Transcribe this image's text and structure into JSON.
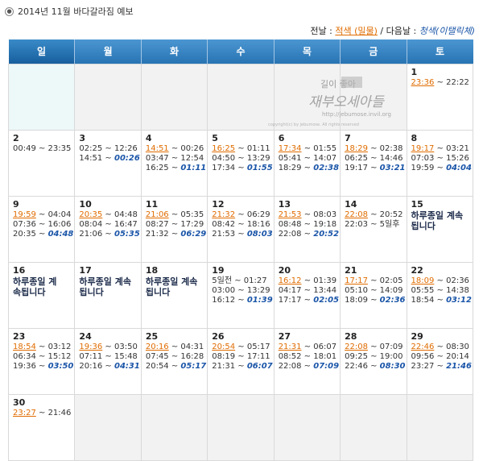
{
  "header": {
    "bullet_icon": "circle-dot-icon",
    "title": "2014년 11월 바다갈라짐 예보"
  },
  "legend": {
    "prefix": "전날 : ",
    "red": "적색 (밀물)",
    "middle": " / 다음날 : ",
    "blue": "청색(이탤릭체)"
  },
  "weekdays": [
    "일",
    "월",
    "화",
    "수",
    "목",
    "금",
    "토"
  ],
  "watermark": {
    "line1": "길이 좋아",
    "line2": "재부오세아들",
    "line3": "http://jebumose.invil.org",
    "line4": "copyright(c) by jebumose. All rights reserved"
  },
  "weeks": [
    [
      {
        "empty": true
      },
      {
        "empty": true
      },
      {
        "empty": true
      },
      {
        "empty": true
      },
      {
        "empty": true
      },
      {
        "empty": true
      },
      {
        "day": "1",
        "lines": [
          [
            {
              "t": "23:36",
              "c": "r"
            },
            {
              "t": " ~ 22:22"
            }
          ]
        ]
      }
    ],
    [
      {
        "day": "2",
        "lines": [
          [
            {
              "t": "00:49 ~ 23:35"
            }
          ]
        ]
      },
      {
        "day": "3",
        "lines": [
          [
            {
              "t": "02:25 ~ 12:26"
            }
          ],
          [
            {
              "t": "14:51 ~ "
            },
            {
              "t": "00:26",
              "c": "b"
            }
          ]
        ]
      },
      {
        "day": "4",
        "lines": [
          [
            {
              "t": "14:51",
              "c": "r"
            },
            {
              "t": " ~ 00:26"
            }
          ],
          [
            {
              "t": "03:47 ~ 12:54"
            }
          ],
          [
            {
              "t": "16:25 ~ "
            },
            {
              "t": "01:11",
              "c": "b"
            }
          ]
        ]
      },
      {
        "day": "5",
        "lines": [
          [
            {
              "t": "16:25",
              "c": "r"
            },
            {
              "t": " ~ 01:11"
            }
          ],
          [
            {
              "t": "04:50 ~ 13:29"
            }
          ],
          [
            {
              "t": "17:34 ~ "
            },
            {
              "t": "01:55",
              "c": "b"
            }
          ]
        ]
      },
      {
        "day": "6",
        "lines": [
          [
            {
              "t": "17:34",
              "c": "r"
            },
            {
              "t": " ~ 01:55"
            }
          ],
          [
            {
              "t": "05:41 ~ 14:07"
            }
          ],
          [
            {
              "t": "18:29 ~ "
            },
            {
              "t": "02:38",
              "c": "b"
            }
          ]
        ]
      },
      {
        "day": "7",
        "lines": [
          [
            {
              "t": "18:29",
              "c": "r"
            },
            {
              "t": " ~ 02:38"
            }
          ],
          [
            {
              "t": "06:25 ~ 14:46"
            }
          ],
          [
            {
              "t": "19:17 ~ "
            },
            {
              "t": "03:21",
              "c": "b"
            }
          ]
        ]
      },
      {
        "day": "8",
        "lines": [
          [
            {
              "t": "19:17",
              "c": "r"
            },
            {
              "t": " ~ 03:21"
            }
          ],
          [
            {
              "t": "07:03 ~ 15:26"
            }
          ],
          [
            {
              "t": "19:59 ~ "
            },
            {
              "t": "04:04",
              "c": "b"
            }
          ]
        ]
      }
    ],
    [
      {
        "day": "9",
        "lines": [
          [
            {
              "t": "19:59",
              "c": "r"
            },
            {
              "t": " ~ 04:04"
            }
          ],
          [
            {
              "t": "07:36 ~ 16:06"
            }
          ],
          [
            {
              "t": "20:35 ~ "
            },
            {
              "t": "04:48",
              "c": "b"
            }
          ]
        ]
      },
      {
        "day": "10",
        "lines": [
          [
            {
              "t": "20:35",
              "c": "r"
            },
            {
              "t": " ~ 04:48"
            }
          ],
          [
            {
              "t": "08:04 ~ 16:47"
            }
          ],
          [
            {
              "t": "21:06 ~ "
            },
            {
              "t": "05:35",
              "c": "b"
            }
          ]
        ]
      },
      {
        "day": "11",
        "lines": [
          [
            {
              "t": "21:06",
              "c": "r"
            },
            {
              "t": " ~ 05:35"
            }
          ],
          [
            {
              "t": "08:27 ~ 17:29"
            }
          ],
          [
            {
              "t": "21:32 ~ "
            },
            {
              "t": "06:29",
              "c": "b"
            }
          ]
        ]
      },
      {
        "day": "12",
        "lines": [
          [
            {
              "t": "21:32",
              "c": "r"
            },
            {
              "t": " ~ 06:29"
            }
          ],
          [
            {
              "t": "08:42 ~ 18:16"
            }
          ],
          [
            {
              "t": "21:53 ~ "
            },
            {
              "t": "08:03",
              "c": "b"
            }
          ]
        ]
      },
      {
        "day": "13",
        "lines": [
          [
            {
              "t": "21:53",
              "c": "r"
            },
            {
              "t": " ~ 08:03"
            }
          ],
          [
            {
              "t": "08:48 ~ 19:18"
            }
          ],
          [
            {
              "t": "22:08 ~ "
            },
            {
              "t": "20:52",
              "c": "b"
            }
          ]
        ]
      },
      {
        "day": "14",
        "lines": [
          [
            {
              "t": "22:08",
              "c": "r"
            },
            {
              "t": " ~ 20:52"
            }
          ],
          [
            {
              "t": "22:03 ~ 5일후"
            }
          ]
        ]
      },
      {
        "day": "15",
        "note": "하루종일 계속\n됩니다"
      }
    ],
    [
      {
        "day": "16",
        "note": "하루종일 계\n속됩니다"
      },
      {
        "day": "17",
        "note": "하루종일 계속\n됩니다"
      },
      {
        "day": "18",
        "note": "하루종일 계속\n됩니다"
      },
      {
        "day": "19",
        "lines": [
          [
            {
              "t": "5일전 ~ 01:27"
            }
          ],
          [
            {
              "t": "03:00 ~ 13:29"
            }
          ],
          [
            {
              "t": "16:12 ~ "
            },
            {
              "t": "01:39",
              "c": "b"
            }
          ]
        ]
      },
      {
        "day": "20",
        "lines": [
          [
            {
              "t": "16:12",
              "c": "r"
            },
            {
              "t": " ~ 01:39"
            }
          ],
          [
            {
              "t": "04:17 ~ 13:44"
            }
          ],
          [
            {
              "t": "17:17 ~ "
            },
            {
              "t": "02:05",
              "c": "b"
            }
          ]
        ]
      },
      {
        "day": "21",
        "lines": [
          [
            {
              "t": "17:17",
              "c": "r"
            },
            {
              "t": " ~ 02:05"
            }
          ],
          [
            {
              "t": "05:10 ~ 14:09"
            }
          ],
          [
            {
              "t": "18:09 ~ "
            },
            {
              "t": "02:36",
              "c": "b"
            }
          ]
        ]
      },
      {
        "day": "22",
        "lines": [
          [
            {
              "t": "18:09",
              "c": "r"
            },
            {
              "t": " ~ 02:36"
            }
          ],
          [
            {
              "t": "05:55 ~ 14:38"
            }
          ],
          [
            {
              "t": "18:54 ~ "
            },
            {
              "t": "03:12",
              "c": "b"
            }
          ]
        ]
      }
    ],
    [
      {
        "day": "23",
        "lines": [
          [
            {
              "t": "18:54",
              "c": "r"
            },
            {
              "t": " ~ 03:12"
            }
          ],
          [
            {
              "t": "06:34 ~ 15:12"
            }
          ],
          [
            {
              "t": "19:36 ~ "
            },
            {
              "t": "03:50",
              "c": "b"
            }
          ]
        ]
      },
      {
        "day": "24",
        "lines": [
          [
            {
              "t": "19:36",
              "c": "r"
            },
            {
              "t": " ~ 03:50"
            }
          ],
          [
            {
              "t": "07:11 ~ 15:48"
            }
          ],
          [
            {
              "t": "20:16 ~ "
            },
            {
              "t": "04:31",
              "c": "b"
            }
          ]
        ]
      },
      {
        "day": "25",
        "lines": [
          [
            {
              "t": "20:16",
              "c": "r"
            },
            {
              "t": " ~ 04:31"
            }
          ],
          [
            {
              "t": "07:45 ~ 16:28"
            }
          ],
          [
            {
              "t": "20:54 ~ "
            },
            {
              "t": "05:17",
              "c": "b"
            }
          ]
        ]
      },
      {
        "day": "26",
        "lines": [
          [
            {
              "t": "20:54",
              "c": "r"
            },
            {
              "t": " ~ 05:17"
            }
          ],
          [
            {
              "t": "08:19 ~ 17:11"
            }
          ],
          [
            {
              "t": "21:31 ~ "
            },
            {
              "t": "06:07",
              "c": "b"
            }
          ]
        ]
      },
      {
        "day": "27",
        "lines": [
          [
            {
              "t": "21:31",
              "c": "r"
            },
            {
              "t": " ~ 06:07"
            }
          ],
          [
            {
              "t": "08:52 ~ 18:01"
            }
          ],
          [
            {
              "t": "22:08 ~ "
            },
            {
              "t": "07:09",
              "c": "b"
            }
          ]
        ]
      },
      {
        "day": "28",
        "lines": [
          [
            {
              "t": "22:08",
              "c": "r"
            },
            {
              "t": " ~ 07:09"
            }
          ],
          [
            {
              "t": "09:25 ~ 19:00"
            }
          ],
          [
            {
              "t": "22:46 ~ "
            },
            {
              "t": "08:30",
              "c": "b"
            }
          ]
        ]
      },
      {
        "day": "29",
        "lines": [
          [
            {
              "t": "22:46",
              "c": "r"
            },
            {
              "t": " ~ 08:30"
            }
          ],
          [
            {
              "t": "09:56 ~ 20:14"
            }
          ],
          [
            {
              "t": "23:27 ~ "
            },
            {
              "t": "21:46",
              "c": "b"
            }
          ]
        ]
      }
    ],
    [
      {
        "day": "30",
        "lines": [
          [
            {
              "t": "23:27",
              "c": "r"
            },
            {
              "t": " ~ 21:46"
            }
          ]
        ]
      },
      {
        "empty": true
      },
      {
        "empty": true
      },
      {
        "empty": true
      },
      {
        "empty": true
      },
      {
        "empty": true
      },
      {
        "empty": true
      }
    ]
  ]
}
